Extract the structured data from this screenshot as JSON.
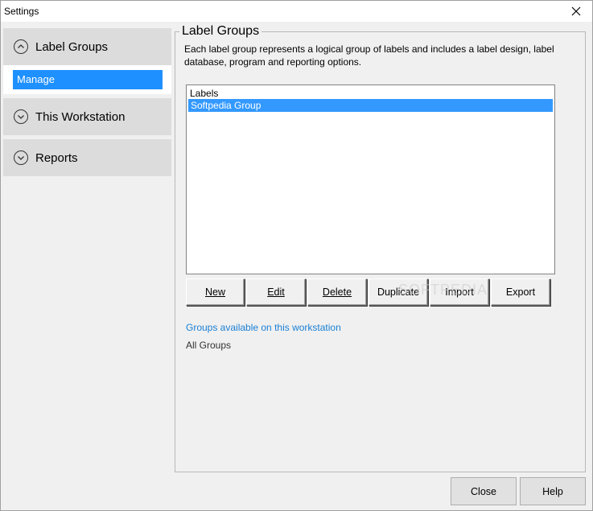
{
  "window": {
    "title": "Settings"
  },
  "sidebar": {
    "sections": [
      {
        "label": "Label Groups",
        "icon": "chevron-up-icon",
        "items": [
          {
            "label": "Manage"
          }
        ]
      },
      {
        "label": "This Workstation",
        "icon": "chevron-down-icon"
      },
      {
        "label": "Reports",
        "icon": "chevron-down-icon"
      }
    ]
  },
  "main": {
    "group_title": "Label Groups",
    "description": "Each label group represents a logical group of labels and includes a label design, label database, program and reporting options.",
    "list": {
      "header": "Labels",
      "items": [
        {
          "label": "Softpedia Group",
          "selected": true
        }
      ]
    },
    "buttons": {
      "new": {
        "label": "New",
        "mnemonic": "N"
      },
      "edit": {
        "label": "Edit",
        "mnemonic": "E"
      },
      "delete": {
        "label": "Delete",
        "mnemonic": "D"
      },
      "duplicate": {
        "label": "Duplicate"
      },
      "import": {
        "label": "Import"
      },
      "export": {
        "label": "Export"
      }
    },
    "watermark": "SOFTPEDIA",
    "availability_link": "Groups available on this workstation",
    "availability_value": "All Groups"
  },
  "footer": {
    "close_label": "Close",
    "help_label": "Help"
  },
  "colors": {
    "selection": "#3399ff",
    "sidebar_selected": "#1e90ff",
    "link": "#1a7fd4",
    "section_bg": "#dcdcdc"
  }
}
